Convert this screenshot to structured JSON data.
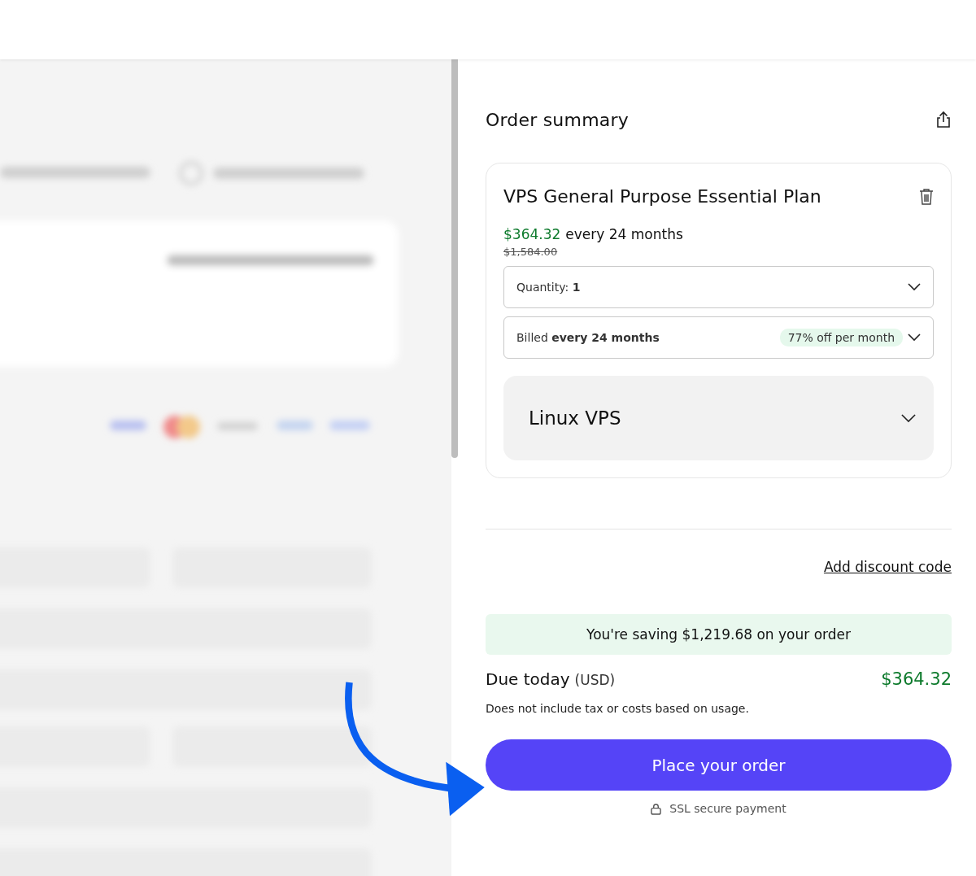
{
  "summary": {
    "title": "Order summary",
    "item": {
      "name": "VPS General Purpose Essential Plan",
      "price": "$364.32",
      "period": "every 24 months",
      "old_price": "$1,584.00",
      "quantity": {
        "label": "Quantity:",
        "value": "1"
      },
      "billing": {
        "text": "Billed **every 24 months**",
        "badge": "77% off per month"
      },
      "addon": {
        "label": "Linux VPS",
        "expanded": false
      }
    },
    "discount_link": "Add discount code",
    "savings": "You're saving $1,219.68 on your order",
    "due": {
      "label": "Due today",
      "currency": "(USD)",
      "amount": "$364.32"
    },
    "note": "Does not include tax or costs based on usage.",
    "order_button": "Place your order",
    "secure": "SSL secure payment"
  }
}
